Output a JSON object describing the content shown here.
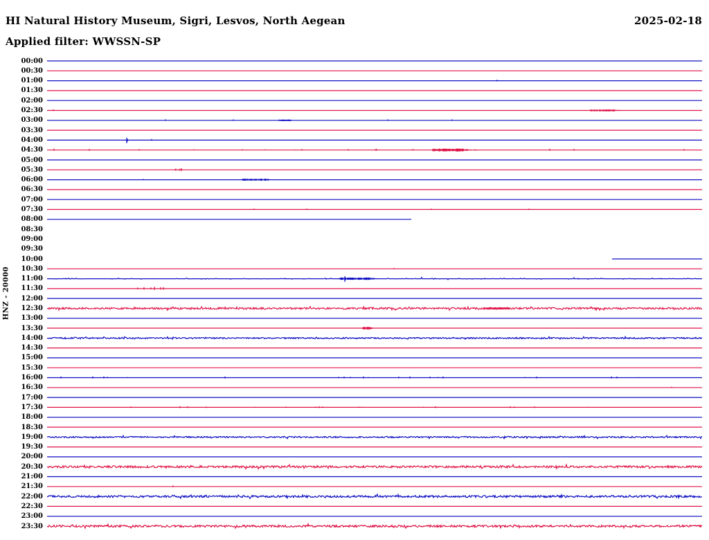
{
  "header": {
    "station_title": "HI Natural History Museum, Sigri, Lesvos, North Aegean",
    "date": "2025-02-18",
    "filter_label": "Applied filter: WWSSN-SP"
  },
  "axis": {
    "channel_label": "HNZ - 20000"
  },
  "chart_data": {
    "type": "line",
    "subtype": "helicorder-daily-seismogram",
    "title": "HI Natural History Museum, Sigri, Lesvos, North Aegean",
    "date": "2025-02-18",
    "filter": "WWSSN-SP",
    "ylabel": "HNZ - 20000",
    "row_duration_minutes": 30,
    "grid": false,
    "colors": {
      "blue": "#0d0dc4",
      "red": "#e01245"
    },
    "rows": [
      {
        "time": "00:00",
        "color": "blue",
        "noise": "none",
        "events": []
      },
      {
        "time": "00:30",
        "color": "red",
        "noise": "none",
        "events": []
      },
      {
        "time": "01:00",
        "color": "blue",
        "noise": "none",
        "events": [
          {
            "kind": "blip",
            "t": 0.687,
            "amp": 1.5
          }
        ]
      },
      {
        "time": "01:30",
        "color": "red",
        "noise": "none",
        "events": []
      },
      {
        "time": "02:00",
        "color": "blue",
        "noise": "none",
        "events": []
      },
      {
        "time": "02:30",
        "color": "red",
        "noise": "none",
        "events": [
          {
            "kind": "blip",
            "t": 0.01,
            "amp": 1.5
          },
          {
            "kind": "burst",
            "t": 0.83,
            "dur": 0.035,
            "amp": 1.6,
            "tail": 0.021
          }
        ]
      },
      {
        "time": "03:00",
        "color": "blue",
        "noise": "none",
        "events": [
          {
            "kind": "blip",
            "t": 0.181,
            "amp": 1.4
          },
          {
            "kind": "blip",
            "t": 0.284,
            "amp": 1.4
          },
          {
            "kind": "burst",
            "t": 0.354,
            "dur": 0.018,
            "amp": 1.3
          },
          {
            "kind": "blip",
            "t": 0.52,
            "amp": 1.4
          },
          {
            "kind": "blip",
            "t": 0.618,
            "amp": 1.4
          }
        ]
      },
      {
        "time": "03:30",
        "color": "red",
        "noise": "none",
        "events": []
      },
      {
        "time": "04:00",
        "color": "blue",
        "noise": "none",
        "events": [
          {
            "kind": "spike",
            "t": 0.122,
            "amp": 4.5
          },
          {
            "kind": "blip",
            "t": 0.16,
            "amp": 1.6
          }
        ]
      },
      {
        "time": "04:30",
        "color": "red",
        "noise": "light",
        "events": [
          {
            "kind": "burst",
            "t": 0.589,
            "dur": 0.045,
            "amp": 2.2,
            "tail": 0.042
          }
        ]
      },
      {
        "time": "05:00",
        "color": "blue",
        "noise": "none",
        "events": []
      },
      {
        "time": "05:30",
        "color": "red",
        "noise": "none",
        "events": [
          {
            "kind": "spikes",
            "t": 0.193,
            "dur": 0.014,
            "amp": 2.6
          }
        ]
      },
      {
        "time": "06:00",
        "color": "blue",
        "noise": "none",
        "events": [
          {
            "kind": "blip",
            "t": 0.147,
            "amp": 1.2
          },
          {
            "kind": "burst",
            "t": 0.298,
            "dur": 0.04,
            "amp": 1.5
          }
        ]
      },
      {
        "time": "06:30",
        "color": "red",
        "noise": "none",
        "events": []
      },
      {
        "time": "07:00",
        "color": "blue",
        "noise": "none",
        "events": []
      },
      {
        "time": "07:30",
        "color": "red",
        "noise": "none",
        "events": [
          {
            "kind": "blip",
            "t": 0.316,
            "amp": 1.2
          },
          {
            "kind": "blip",
            "t": 0.396,
            "amp": 1.2
          },
          {
            "kind": "blip",
            "t": 0.587,
            "amp": 1.2
          },
          {
            "kind": "blip",
            "t": 0.736,
            "amp": 1.2
          }
        ]
      },
      {
        "time": "08:00",
        "color": "blue",
        "noise": "none",
        "x_end": 0.556,
        "events": []
      },
      {
        "time": "08:30",
        "color": "red",
        "missing": true
      },
      {
        "time": "09:00",
        "color": "blue",
        "missing": true
      },
      {
        "time": "09:30",
        "color": "red",
        "missing": true
      },
      {
        "time": "10:00",
        "color": "blue",
        "noise": "none",
        "x_start": 0.863,
        "events": []
      },
      {
        "time": "10:30",
        "color": "red",
        "noise": "none",
        "events": [
          {
            "kind": "blip",
            "t": 0.53,
            "amp": 1.2
          }
        ]
      },
      {
        "time": "11:00",
        "color": "blue",
        "noise": "medium",
        "namp": 0.9,
        "events": [
          {
            "kind": "burst",
            "t": 0.446,
            "dur": 0.048,
            "amp": 1.8,
            "tail": 0.02
          },
          {
            "kind": "spike",
            "t": 0.455,
            "amp": 4.5
          },
          {
            "kind": "blip",
            "t": 0.029,
            "amp": 1.2
          },
          {
            "kind": "blip",
            "t": 0.364,
            "amp": 1.2
          },
          {
            "kind": "blip",
            "t": 0.592,
            "amp": 1.3
          },
          {
            "kind": "blip",
            "t": 0.668,
            "amp": 1.2
          },
          {
            "kind": "blip",
            "t": 0.811,
            "amp": 1.2
          },
          {
            "kind": "blip",
            "t": 0.938,
            "amp": 1.2
          }
        ]
      },
      {
        "time": "11:30",
        "color": "red",
        "noise": "none",
        "events": [
          {
            "kind": "spikes",
            "t": 0.137,
            "dur": 0.042,
            "amp": 3
          }
        ]
      },
      {
        "time": "12:00",
        "color": "blue",
        "noise": "none",
        "events": []
      },
      {
        "time": "12:30",
        "color": "red",
        "noise": "heavy",
        "namp": 1.3,
        "events": [
          {
            "kind": "burst",
            "t": 0.668,
            "dur": 0.038,
            "amp": 1.8
          }
        ]
      },
      {
        "time": "13:00",
        "color": "blue",
        "noise": "none",
        "events": []
      },
      {
        "time": "13:30",
        "color": "red",
        "noise": "none",
        "events": [
          {
            "kind": "burst",
            "t": 0.482,
            "dur": 0.014,
            "amp": 2.2
          }
        ]
      },
      {
        "time": "14:00",
        "color": "blue",
        "noise": "heavy",
        "namp": 1.0,
        "events": []
      },
      {
        "time": "14:30",
        "color": "red",
        "noise": "none",
        "events": []
      },
      {
        "time": "15:00",
        "color": "blue",
        "noise": "none",
        "events": []
      },
      {
        "time": "15:30",
        "color": "red",
        "noise": "none",
        "events": []
      },
      {
        "time": "16:00",
        "color": "blue",
        "noise": "light",
        "events": []
      },
      {
        "time": "16:30",
        "color": "red",
        "noise": "none",
        "events": [
          {
            "kind": "blip",
            "t": 0.954,
            "amp": 1.2
          }
        ]
      },
      {
        "time": "17:00",
        "color": "blue",
        "noise": "none",
        "events": []
      },
      {
        "time": "17:30",
        "color": "red",
        "noise": "light",
        "events": []
      },
      {
        "time": "18:00",
        "color": "blue",
        "noise": "none",
        "events": []
      },
      {
        "time": "18:30",
        "color": "red",
        "noise": "none",
        "events": []
      },
      {
        "time": "19:00",
        "color": "blue",
        "noise": "heavy",
        "namp": 1.0,
        "events": []
      },
      {
        "time": "19:30",
        "color": "red",
        "noise": "none",
        "events": []
      },
      {
        "time": "20:00",
        "color": "blue",
        "noise": "none",
        "events": []
      },
      {
        "time": "20:30",
        "color": "red",
        "noise": "heavy",
        "namp": 1.5,
        "events": []
      },
      {
        "time": "21:00",
        "color": "blue",
        "noise": "none",
        "events": []
      },
      {
        "time": "21:30",
        "color": "red",
        "noise": "none",
        "events": [
          {
            "kind": "blip",
            "t": 0.192,
            "amp": 1.5
          }
        ]
      },
      {
        "time": "22:00",
        "color": "blue",
        "noise": "heavy",
        "namp": 1.5,
        "events": []
      },
      {
        "time": "22:30",
        "color": "red",
        "noise": "none",
        "events": []
      },
      {
        "time": "23:00",
        "color": "blue",
        "noise": "none",
        "events": []
      },
      {
        "time": "23:30",
        "color": "red",
        "noise": "heavy",
        "namp": 1.5,
        "events": []
      }
    ]
  }
}
